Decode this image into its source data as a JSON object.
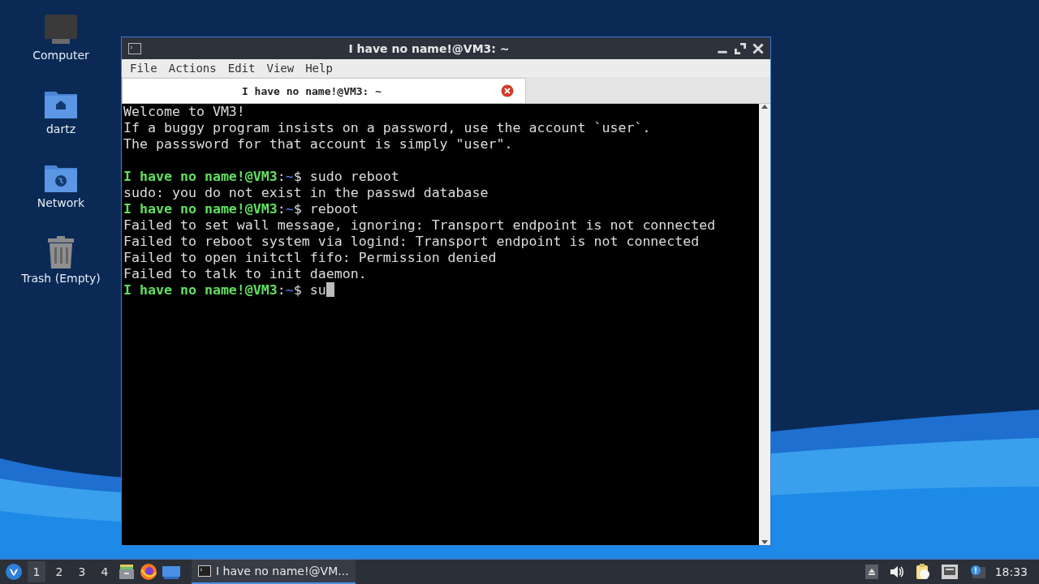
{
  "desktop_icons": [
    {
      "label": "Computer",
      "kind": "monitor"
    },
    {
      "label": "dartz",
      "kind": "home"
    },
    {
      "label": "Network",
      "kind": "network"
    },
    {
      "label": "Trash (Empty)",
      "kind": "trash"
    }
  ],
  "window": {
    "title": "I have no name!@VM3: ~",
    "menu": [
      "File",
      "Actions",
      "Edit",
      "View",
      "Help"
    ],
    "tabs": [
      {
        "label": "I have no name!@VM3: ~",
        "selected": true
      }
    ],
    "terminal": [
      {
        "kind": "output",
        "text": "Welcome to VM3!"
      },
      {
        "kind": "output",
        "text": "If a buggy program insists on a password, use the account `user`."
      },
      {
        "kind": "output",
        "text": "The passsword for that account is simply \"user\"."
      },
      {
        "kind": "blank"
      },
      {
        "kind": "prompt",
        "user": "I have no name!@VM3",
        "separator": ":",
        "path": "~",
        "symbol": "$",
        "command": "sudo reboot"
      },
      {
        "kind": "output",
        "text": "sudo: you do not exist in the passwd database"
      },
      {
        "kind": "prompt",
        "user": "I have no name!@VM3",
        "separator": ":",
        "path": "~",
        "symbol": "$",
        "command": "reboot"
      },
      {
        "kind": "output",
        "text": "Failed to set wall message, ignoring: Transport endpoint is not connected"
      },
      {
        "kind": "output",
        "text": "Failed to reboot system via logind: Transport endpoint is not connected"
      },
      {
        "kind": "output",
        "text": "Failed to open initctl fifo: Permission denied"
      },
      {
        "kind": "output",
        "text": "Failed to talk to init daemon."
      },
      {
        "kind": "prompt",
        "user": "I have no name!@VM3",
        "separator": ":",
        "path": "~",
        "symbol": "$",
        "command": "su",
        "cursor": true
      }
    ]
  },
  "taskbar": {
    "workspaces": [
      {
        "label": "1",
        "selected": true
      },
      {
        "label": "2",
        "selected": false
      },
      {
        "label": "3",
        "selected": false
      },
      {
        "label": "4",
        "selected": false
      }
    ],
    "launchers": [
      {
        "kind": "files"
      },
      {
        "kind": "browser"
      },
      {
        "kind": "desktop"
      }
    ],
    "tasks": [
      {
        "label": "I have no name!@VM...",
        "selected": true
      }
    ],
    "tray": [
      {
        "kind": "eject"
      },
      {
        "kind": "volume"
      },
      {
        "kind": "clipboard"
      },
      {
        "kind": "network"
      },
      {
        "kind": "notification"
      }
    ],
    "clock": "18:33"
  }
}
